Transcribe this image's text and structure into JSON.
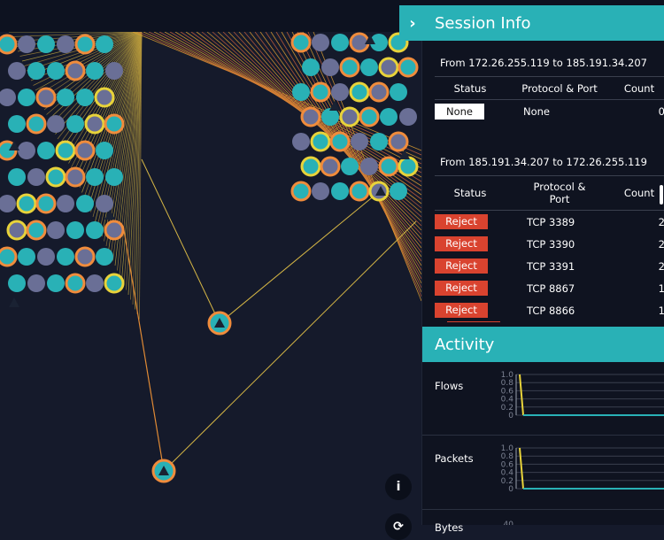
{
  "session": {
    "title": "Session Info",
    "a_to_b": {
      "label": "From 172.26.255.119 to 185.191.34.207",
      "headers": [
        "Status",
        "Protocol & Port",
        "Count"
      ],
      "rows": [
        {
          "status": "None",
          "proto": "None",
          "count": "0"
        }
      ]
    },
    "b_to_a": {
      "label": "From 185.191.34.207 to 172.26.255.119",
      "headers": [
        "Status",
        "Protocol & Port",
        "Count"
      ],
      "rows": [
        {
          "status": "Reject",
          "proto": "TCP 3389",
          "count": "2"
        },
        {
          "status": "Reject",
          "proto": "TCP 3390",
          "count": "2"
        },
        {
          "status": "Reject",
          "proto": "TCP 3391",
          "count": "2"
        },
        {
          "status": "Reject",
          "proto": "TCP 8867",
          "count": "1"
        },
        {
          "status": "Reject",
          "proto": "TCP 8866",
          "count": "1"
        }
      ]
    }
  },
  "activity": {
    "title": "Activity",
    "metrics": [
      {
        "label": "Flows",
        "ticks": [
          "1.0",
          "0.8",
          "0.6",
          "0.4",
          "0.2",
          "0"
        ]
      },
      {
        "label": "Packets",
        "ticks": [
          "1.0",
          "0.8",
          "0.6",
          "0.4",
          "0.2",
          "0"
        ]
      },
      {
        "label": "Bytes",
        "ticks": [
          "40"
        ]
      }
    ]
  },
  "colors": {
    "teal": "#29b1b6",
    "reject": "#d9432f",
    "orange": "#f08c3c",
    "yellow": "#e8d33a",
    "slate": "#6a6f96"
  }
}
